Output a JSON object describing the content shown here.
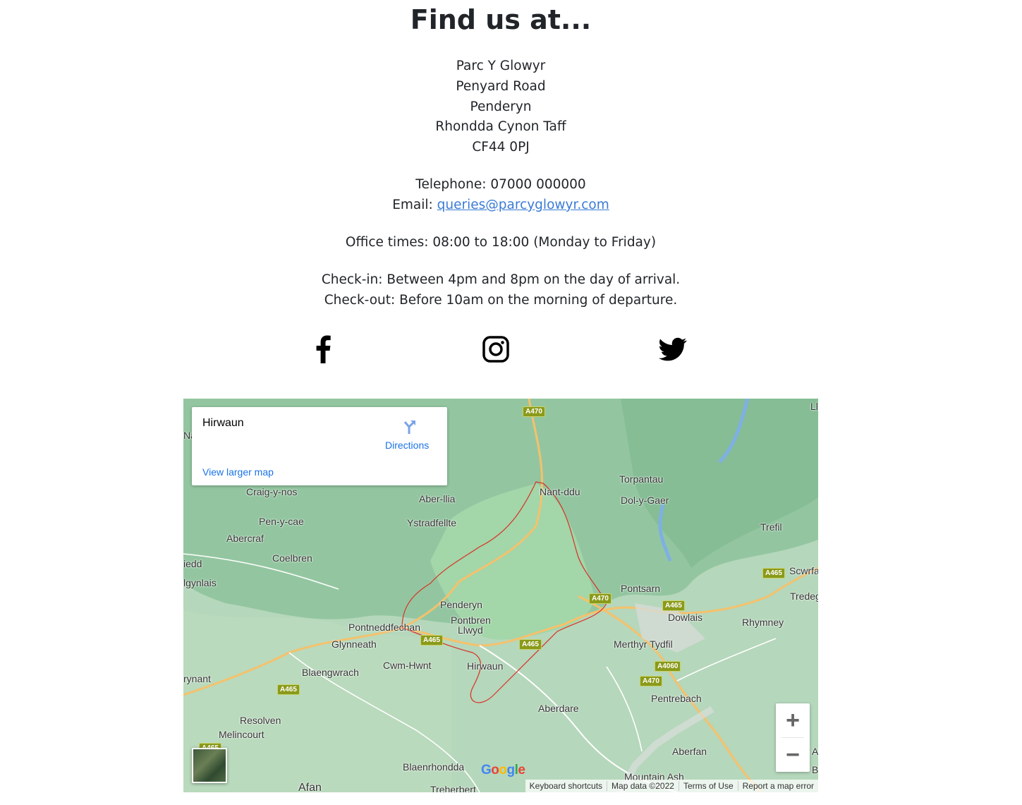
{
  "heading": "Find us at...",
  "address": [
    "Parc Y Glowyr",
    "Penyard Road",
    "Penderyn",
    "Rhondda Cynon Taff",
    "CF44 0PJ"
  ],
  "contact": {
    "telephone_label": "Telephone: 07000 000000",
    "email_label": "Email:",
    "email": "queries@parcyglowyr.com"
  },
  "office_times": "Office times: 08:00 to 18:00 (Monday to Friday)",
  "checkin": "Check-in: Between 4pm and 8pm on the day of arrival.",
  "checkout": "Check-out: Before 10am on the morning of departure.",
  "social": [
    "facebook-icon",
    "instagram-icon",
    "twitter-icon"
  ],
  "map": {
    "place": "Hirwaun",
    "directions_label": "Directions",
    "larger_map_label": "View larger map",
    "zoom_in": "+",
    "zoom_out": "−",
    "google": "Google",
    "footer": [
      "Keyboard shortcuts",
      "Map data ©2022",
      "Terms of Use",
      "Report a map error"
    ],
    "labels": [
      "Craig-y-nos",
      "Pen-y-cae",
      "Abercraf",
      "Coelbren",
      "iedd",
      "lgynlais",
      "Aber-llia",
      "Ystradfellte",
      "Nant-ddu",
      "Torpantau",
      "Dol-y-Gaer",
      "Trefil",
      "Pontsarn",
      "Dowlais",
      "Rhymney",
      "Tredeg",
      "Scwrfa",
      "Penderyn",
      "Pontbren",
      "Llwyd",
      "Pontneddfechan",
      "Glynneath",
      "Cwm-Hwnt",
      "Hirwaun",
      "Blaengwrach",
      "rynant",
      "Merthyr Tydfil",
      "Pentrebach",
      "Aberdare",
      "Resolven",
      "Melincourt",
      "Aberfan",
      "Blaenrhondda",
      "Mountain Ash",
      "Afan",
      "Treherbert",
      "Na",
      "Ll",
      "A",
      "B"
    ],
    "roads": [
      "A470",
      "A465",
      "A470",
      "A465",
      "A465",
      "A465",
      "A465",
      "A4060",
      "A470",
      "A465"
    ]
  },
  "colors": {
    "link": "#3a7bd5",
    "map_green": "#b2d4b8",
    "park_green": "#a3d6a9",
    "boundary": "#d93025"
  }
}
